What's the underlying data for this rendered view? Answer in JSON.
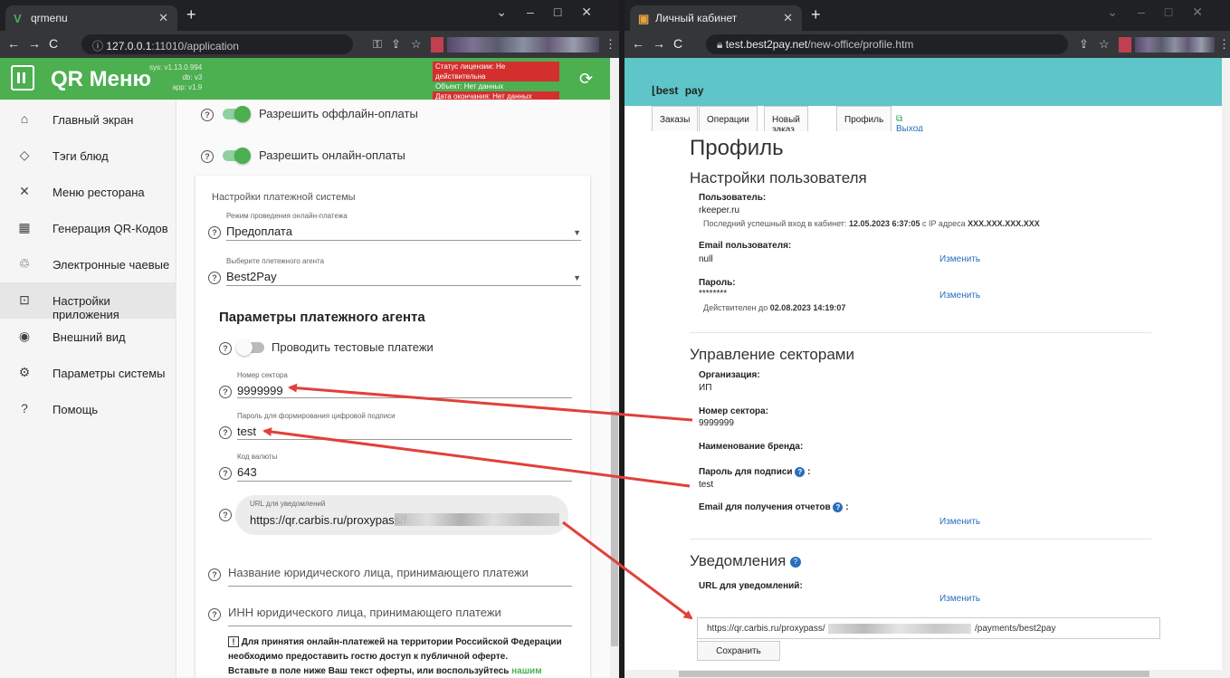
{
  "win1": {
    "tab_title": "qrmenu",
    "url_host": "127.0.0.1",
    "url_rest": ":11010/application",
    "app": {
      "brand": "QR Меню",
      "versions": [
        "sys: v1.13.0.994",
        "db: v3",
        "app: v1.9"
      ],
      "license": {
        "status": "Статус лицензии: Не действительна",
        "object": "Объект: Нет данных",
        "end": "Дата окончания: Нет данных"
      }
    },
    "sidebar": [
      {
        "label": "Главный экран",
        "icon": "home-icon"
      },
      {
        "label": "Тэги блюд",
        "icon": "tag-icon"
      },
      {
        "label": "Меню ресторана",
        "icon": "utensils-icon"
      },
      {
        "label": "Генерация QR-Кодов",
        "icon": "qr-code-icon"
      },
      {
        "label": "Электронные чаевые",
        "icon": "tips-icon"
      },
      {
        "label": "Настройки приложения",
        "icon": "settings-app-icon"
      },
      {
        "label": "Внешний вид",
        "icon": "eye-icon"
      },
      {
        "label": "Параметры системы",
        "icon": "gear-icon"
      },
      {
        "label": "Помощь",
        "icon": "help-icon"
      }
    ],
    "settings": {
      "offline": "Разрешить оффлайн-оплаты",
      "online": "Разрешить онлайн-оплаты",
      "card_title": "Настройки платежной системы",
      "mode_label": "Режим проведения онлайн-платежа",
      "mode_value": "Предоплата",
      "agent_label": "Выберите плетежного агента",
      "agent_value": "Best2Pay",
      "params_title": "Параметры платежного агента",
      "test_payments": "Проводить тестовые платежи",
      "sector_label": "Номер сектора",
      "sector_value": "9999999",
      "sign_label": "Пароль для формирования цифровой подписи",
      "sign_value": "test",
      "currency_label": "Код валюты",
      "currency_value": "643",
      "notify_label": "URL для уведомлений",
      "notify_value": "https://qr.carbis.ru/proxypass/f",
      "legal_name": "Название юридического лица, принимающего платежи",
      "legal_inn": "ИНН юридического лица, принимающего платежи",
      "note_line1": "Для принятия онлайн-платежей на территории Российской Федерации",
      "note_line2": "необходимо предоставить гостю доступ к публичной оферте.",
      "note_line3": "Вставьте в поле ниже Ваш текст оферты, или воспользуйтесь",
      "note_link": "нашим шаблоном"
    }
  },
  "win2": {
    "tab_title": "Личный кабинет",
    "url_host": "test.best2pay.net",
    "url_rest": "/new-office/profile.htm",
    "logo_a": "best",
    "logo_b": "pay",
    "tabs": [
      "Заказы",
      "Операции",
      "Новый заказ",
      "Профиль"
    ],
    "exit": "Выход",
    "profile": {
      "title": "Профиль",
      "user_settings": "Настройки пользователя",
      "user_label": "Пользователь:",
      "user_value": "rkeeper.ru",
      "last_login_prefix": "Последний успешный вход в кабинет:",
      "last_login_date": "12.05.2023 6:37:05",
      "last_login_ip_prefix": "с IP адреса",
      "last_login_ip": "XXX.XXX.XXX.XXX",
      "email_label": "Email пользователя:",
      "email_value": "null",
      "change": "Изменить",
      "password_label": "Пароль:",
      "password_value": "********",
      "valid_prefix": "Действителен до",
      "valid_date": "02.08.2023 14:19:07",
      "sectors_title": "Управление секторами",
      "org_label": "Организация:",
      "org_value": "ИП",
      "sector_label": "Номер сектора:",
      "sector_value": "9999999",
      "brand_label": "Наименование бренда:",
      "sign_label": "Пароль для подписи",
      "sign_value": "test",
      "report_label": "Email для получения отчетов",
      "notify_title": "Уведомления",
      "notify_url_label": "URL для уведомлений:",
      "notify_url_start": "https://qr.carbis.ru/proxypass/",
      "notify_url_end": "/payments/best2pay",
      "save": "Сохранить"
    }
  }
}
